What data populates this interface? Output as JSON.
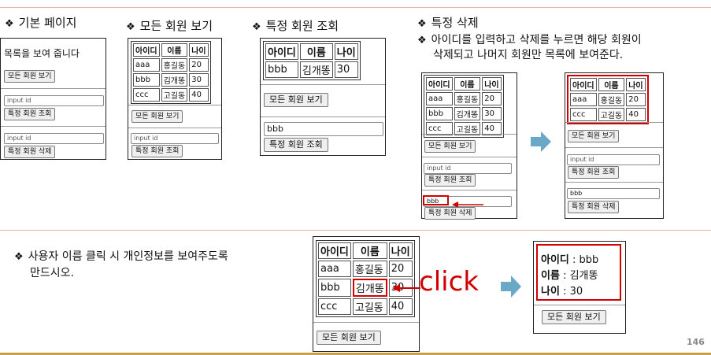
{
  "bullet_symbol": "❖",
  "sections": {
    "basic_page": {
      "heading": "기본 페이지",
      "subtitle": "목록을 보여 줍니다",
      "show_all_button": "모든 회원 보기",
      "input_placeholder": "input id",
      "lookup_button": "특정 회원 조회",
      "delete_input_placeholder": "input id",
      "delete_button": "특정 회원 삭제"
    },
    "view_all": {
      "heading": "모든 회원 보기",
      "columns": [
        "아이디",
        "이름",
        "나이"
      ],
      "rows": [
        [
          "aaa",
          "홍길동",
          "20"
        ],
        [
          "bbb",
          "김개똥",
          "30"
        ],
        [
          "ccc",
          "고길동",
          "40"
        ]
      ],
      "show_all_button": "모든 회원 보기",
      "input_placeholder": "input id",
      "lookup_button": "특정 회원 조회"
    },
    "lookup": {
      "heading": "특정 회원 조회",
      "columns": [
        "아이디",
        "이름",
        "나이"
      ],
      "row": [
        "bbb",
        "김개똥",
        "30"
      ],
      "show_all_button": "모든 회원 보기",
      "input_value": "bbb",
      "lookup_button": "특정 회원 조회"
    },
    "delete": {
      "heading": "특정 삭제",
      "description_line1": "아이디를 입력하고 삭제를 누르면 해당 회원이",
      "description_line2": "삭제되고 나머지 회원만 목록에 보여준다.",
      "before": {
        "columns": [
          "아이디",
          "이름",
          "나이"
        ],
        "rows": [
          [
            "aaa",
            "홍길동",
            "20"
          ],
          [
            "bbb",
            "김개똥",
            "30"
          ],
          [
            "ccc",
            "고길동",
            "40"
          ]
        ],
        "show_all_button": "모든 회원 보기",
        "input_placeholder": "input id",
        "lookup_button": "특정 회원 조회",
        "delete_input_value": "bbb",
        "delete_button": "특정 회원 삭제"
      },
      "after": {
        "columns": [
          "아이디",
          "이름",
          "나이"
        ],
        "rows": [
          [
            "aaa",
            "홍길동",
            "20"
          ],
          [
            "ccc",
            "고길동",
            "40"
          ]
        ],
        "show_all_button": "모든 회원 보기",
        "input_placeholder": "input id",
        "lookup_button": "특정 회원 조회",
        "delete_input_value": "bbb",
        "delete_button": "특정 회원 삭제"
      }
    },
    "detail": {
      "instruction_line1": "사용자 이름 클릭 시 개인정보를 보여주도록",
      "instruction_line2": "만드시오.",
      "columns": [
        "아이디",
        "이름",
        "나이"
      ],
      "rows": [
        [
          "aaa",
          "홍길동",
          "20"
        ],
        [
          "bbb",
          "김개똥",
          "30"
        ],
        [
          "ccc",
          "고길동",
          "40"
        ]
      ],
      "show_all_button": "모든 회원 보기",
      "click_label": "click",
      "info_id_label": "아이디",
      "info_id_value": ": bbb",
      "info_name_label": "이름",
      "info_name_value": ": 김개똥",
      "info_age_label": "나이",
      "info_age_value": ": 30",
      "info_button": "모든 회원 보기"
    }
  },
  "page_number": "146",
  "colors": {
    "top_rule": "#e8b0a8",
    "mid_rule": "#e8b0a8",
    "footer_rule": "#c8a04c",
    "highlight_red": "#d00000",
    "arrow_blue": "#6aa8c8"
  }
}
